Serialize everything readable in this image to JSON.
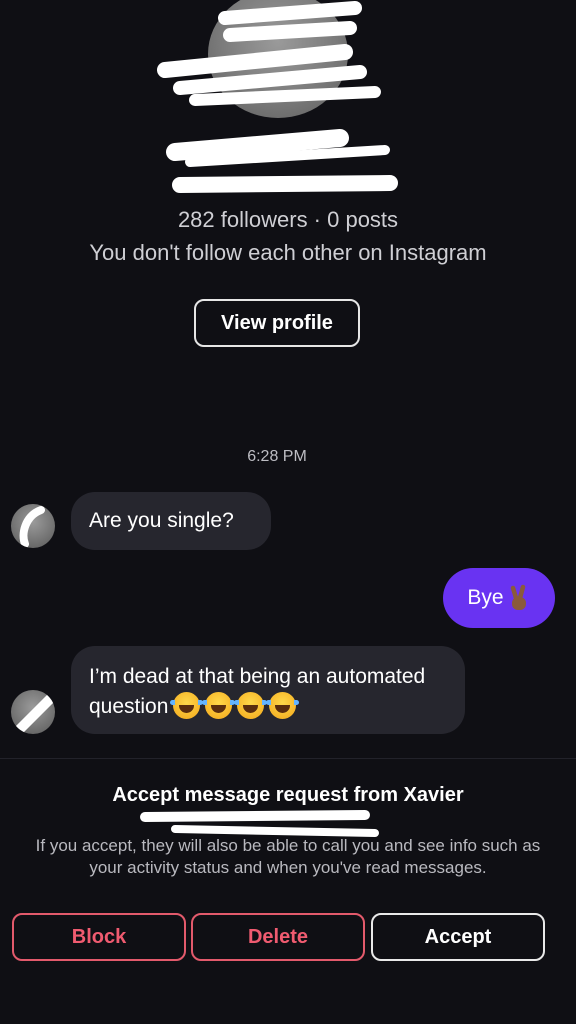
{
  "profile": {
    "name_redacted": "Xavier",
    "stats": "282 followers · 0 posts",
    "relationship_note": "You don't follow each other on Instagram",
    "view_profile_label": "View profile"
  },
  "chat": {
    "timestamp": "6:28 PM",
    "messages": [
      {
        "from": "them",
        "text": "Are you single?"
      },
      {
        "from": "me",
        "text": "Bye",
        "emoji": "victory-hand"
      },
      {
        "from": "them",
        "text": "I’m dead at that being an automated question",
        "emoji_count": 4,
        "emoji": "face-with-tears-of-joy"
      }
    ]
  },
  "request": {
    "title": "Accept message request from Xavier",
    "info": "If you accept, they will also be able to call you and see info such as your activity status and when you've read messages.",
    "buttons": {
      "block": "Block",
      "delete": "Delete",
      "accept": "Accept"
    }
  },
  "colors": {
    "background": "#0f0f14",
    "incoming_bubble": "#26262e",
    "outgoing_bubble": "#6933f2",
    "danger": "#f05b70"
  }
}
